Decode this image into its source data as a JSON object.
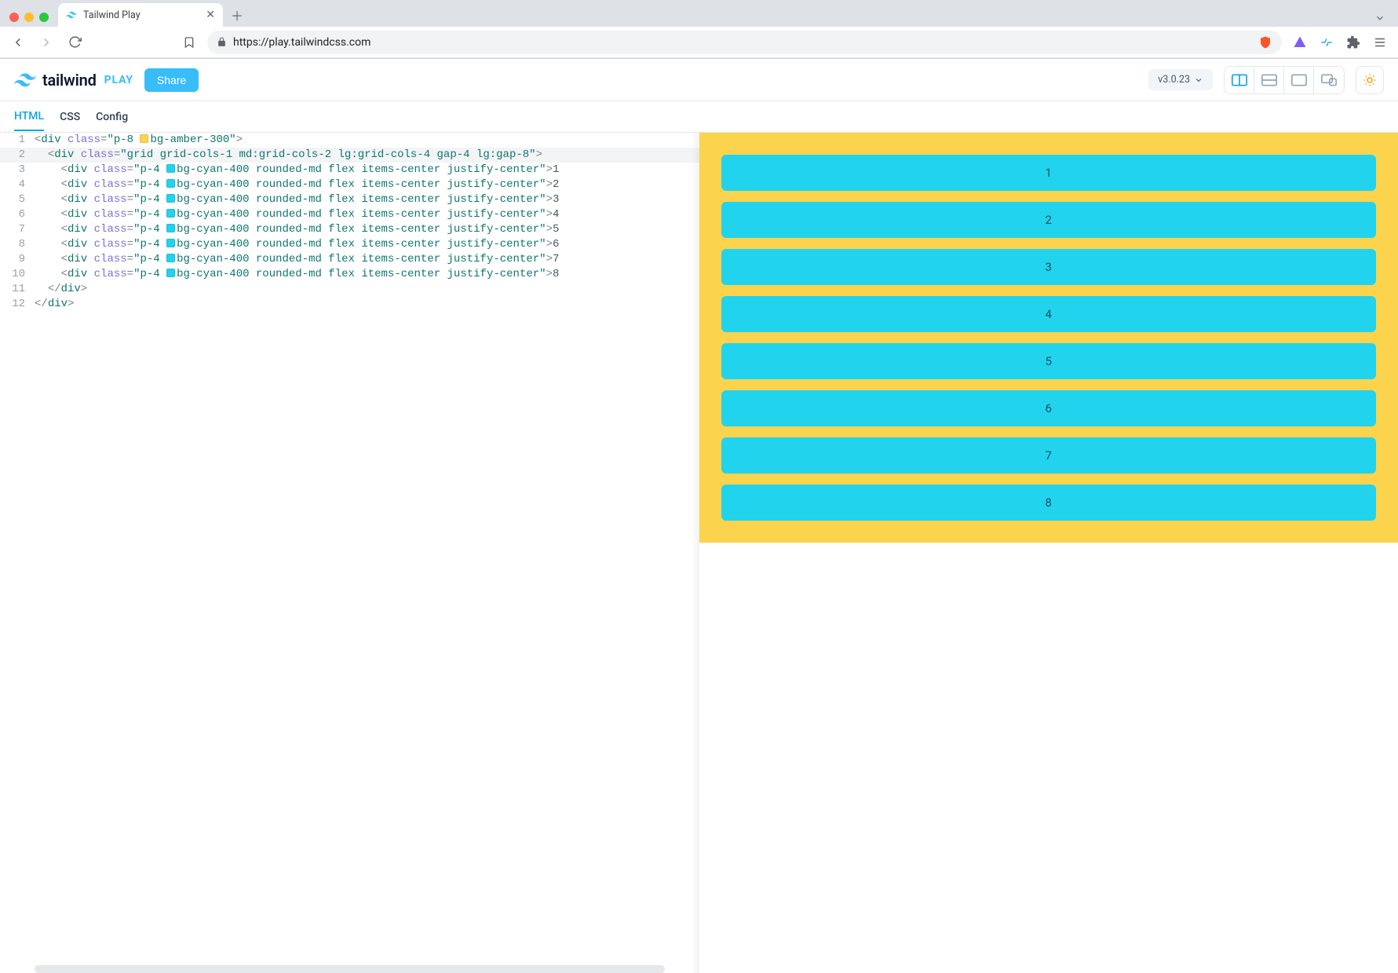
{
  "browser": {
    "tab_title": "Tailwind Play",
    "url": "https://play.tailwindcss.com"
  },
  "header": {
    "brand": "tailwind",
    "brand_suffix": "PLAY",
    "share_label": "Share",
    "version": "v3.0.23"
  },
  "editor_tabs": {
    "html": "HTML",
    "css": "CSS",
    "config": "Config"
  },
  "code": {
    "line_count": 12,
    "outer_class": "p-8 bg-amber-300",
    "grid_class": "grid grid-cols-1 md:grid-cols-2 lg:grid-cols-4 gap-4 lg:gap-8",
    "item_class": "p-4 bg-cyan-400 rounded-md flex items-center justify-center",
    "outer_class_pre": "p-8 ",
    "outer_class_color": "bg-amber-300",
    "item_class_pre": "p-4 ",
    "item_class_color": "bg-cyan-400",
    "item_class_post": " rounded-md flex items-center justify-center",
    "items": [
      "1",
      "2",
      "3",
      "4",
      "5",
      "6",
      "7",
      "8"
    ]
  },
  "preview": {
    "items": [
      "1",
      "2",
      "3",
      "4",
      "5",
      "6",
      "7",
      "8"
    ]
  }
}
